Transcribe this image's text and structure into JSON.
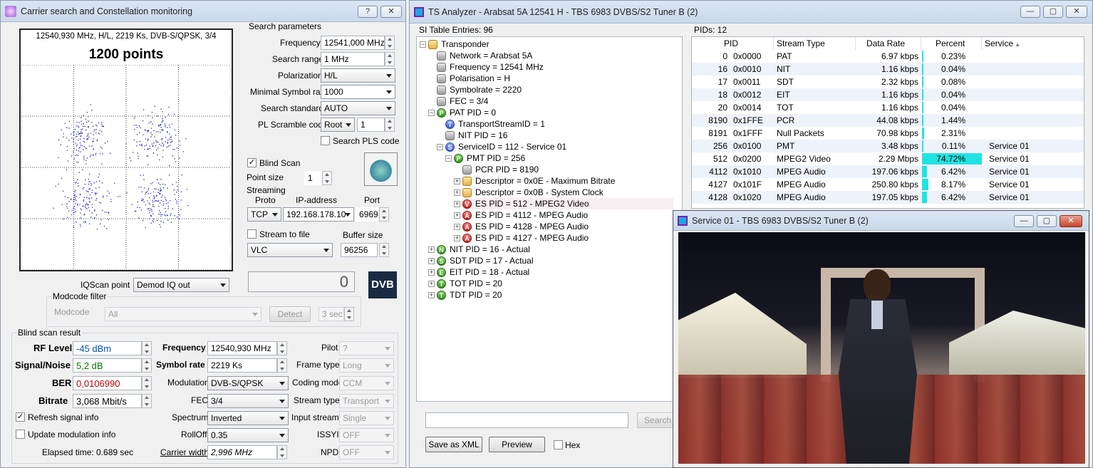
{
  "left_window": {
    "title": "Carrier search and Constellation monitoring",
    "help_btn": "?",
    "close_btn": "✕",
    "constellation": {
      "header": "12540,930 MHz, H/L, 2219 Ks, DVB-S/QPSK, 3/4",
      "points_label": "1200 points"
    },
    "search_params": {
      "title": "Search parameters",
      "frequency_label": "Frequency",
      "frequency_value": "12541,000 MHz",
      "range_label": "Search range",
      "range_value": "1 MHz",
      "polarization_label": "Polarization",
      "polarization_value": "H/L",
      "min_sr_label": "Minimal Symbol rate",
      "min_sr_value": "1000",
      "standard_label": "Search standard",
      "standard_value": "AUTO",
      "pls_label": "PL Scramble code",
      "pls_mode": "Root",
      "pls_value": "1",
      "search_pls_label": "Search PLS code"
    },
    "blind_scan_label": "Blind Scan",
    "point_size_label": "Point size",
    "point_size_value": "1",
    "streaming": {
      "title": "Streaming",
      "proto_label": "Proto",
      "ip_label": "IP-address",
      "port_label": "Port",
      "proto_value": "TCP",
      "ip_value": "192.168.178.10",
      "port_value": "6969"
    },
    "stream_to_file_label": "Stream to file",
    "buffer_label": "Buffer size",
    "player_value": "VLC",
    "buffer_value": "96256",
    "iqscan_label": "IQScan point",
    "iqscan_value": "Demod IQ out",
    "counter_value": "0",
    "dvb_logo": "DVB",
    "modcode_filter": {
      "title": "Modcode filter",
      "label": "Modcode",
      "value": "All",
      "detect": "Detect",
      "sec": "3 sec"
    },
    "result": {
      "title": "Blind scan result",
      "rf_label": "RF Level",
      "rf_value": "-45 dBm",
      "sn_label": "Signal/Noise",
      "sn_value": "5,2 dB",
      "ber_label": "BER",
      "ber_value": "0,0106990",
      "bitrate_label": "Bitrate",
      "bitrate_value": "3,068 Mbit/s",
      "freq_label": "Frequency",
      "freq_value": "12540,930 MHz",
      "sr_label": "Symbol rate",
      "sr_value": "2219 Ks",
      "mod_label": "Modulation",
      "mod_value": "DVB-S/QPSK",
      "fec_label": "FEC",
      "fec_value": "3/4",
      "spectrum_label": "Spectrum",
      "spectrum_value": "Inverted",
      "rolloff_label": "RollOff",
      "rolloff_value": "0.35",
      "cw_label": "Carrier width",
      "cw_value": "2,996 MHz",
      "pilot_label": "Pilot",
      "pilot_value": "?",
      "frame_label": "Frame type",
      "frame_value": "Long",
      "coding_label": "Coding mode",
      "coding_value": "CCM",
      "stype_label": "Stream type",
      "stype_value": "Transport",
      "istream_label": "Input stream",
      "istream_value": "Single",
      "issyi_label": "ISSYI",
      "issyi_value": "OFF",
      "npd_label": "NPD",
      "npd_value": "OFF",
      "refresh_label": "Refresh signal info",
      "update_label": "Update modulation info",
      "elapsed": "Elapsed time: 0.689 sec"
    }
  },
  "ts_window": {
    "title": "TS Analyzer - Arabsat 5A 12541 H - TBS 6983 DVBS/S2 Tuner B (2)",
    "si_label": "SI Table Entries: 96",
    "pids_label": "PIDs: 12",
    "tree": [
      {
        "text": "Transponder",
        "icon": "folder",
        "letter": ""
      },
      {
        "text": "Network = Arabsat 5A",
        "icon": "grey",
        "letter": ""
      },
      {
        "text": "Frequency = 12541 MHz",
        "icon": "grey",
        "letter": ""
      },
      {
        "text": "Polarisation = H",
        "icon": "grey",
        "letter": ""
      },
      {
        "text": "Symbolrate = 2220",
        "icon": "grey",
        "letter": ""
      },
      {
        "text": "FEC = 3/4",
        "icon": "grey",
        "letter": ""
      },
      {
        "text": "PAT PID = 0",
        "icon": "P",
        "letter": "P"
      },
      {
        "text": "TransportStreamID = 1",
        "icon": "T",
        "letter": "T"
      },
      {
        "text": "NIT PID = 16",
        "icon": "grey",
        "letter": ""
      },
      {
        "text": "ServiceID = 112 - Service 01",
        "icon": "Sv",
        "letter": "S"
      },
      {
        "text": "PMT PID = 256",
        "icon": "P",
        "letter": "P"
      },
      {
        "text": "PCR PID = 8190",
        "icon": "grey",
        "letter": ""
      },
      {
        "text": "Descriptor = 0x0E - Maximum Bitrate",
        "icon": "folder",
        "letter": ""
      },
      {
        "text": "Descriptor = 0x0B - System Clock",
        "icon": "folder",
        "letter": ""
      },
      {
        "text": "ES PID = 512 - MPEG2 Video",
        "icon": "V",
        "letter": "V"
      },
      {
        "text": "ES PID = 4112 - MPEG Audio",
        "icon": "A",
        "letter": "A"
      },
      {
        "text": "ES PID = 4128 - MPEG Audio",
        "icon": "A",
        "letter": "A"
      },
      {
        "text": "ES PID = 4127 - MPEG Audio",
        "icon": "A",
        "letter": "A"
      },
      {
        "text": "NIT PID = 16 - Actual",
        "icon": "N",
        "letter": "N"
      },
      {
        "text": "SDT PID = 17 - Actual",
        "icon": "S",
        "letter": "S"
      },
      {
        "text": "EIT PID = 18 - Actual",
        "icon": "E",
        "letter": "E"
      },
      {
        "text": "TOT PID = 20",
        "icon": "T2",
        "letter": "T"
      },
      {
        "text": "TDT PID = 20",
        "icon": "T2",
        "letter": "T"
      }
    ],
    "pid_headers": [
      "PID",
      "Stream Type",
      "Data Rate",
      "Percent",
      "Service"
    ],
    "pid_rows": [
      {
        "pid": "0",
        "hex": "0x0000",
        "type": "PAT",
        "rate": "6.97 kbps",
        "pct": "0.23%",
        "pctv": 0.23,
        "svc": ""
      },
      {
        "pid": "16",
        "hex": "0x0010",
        "type": "NIT",
        "rate": "1.16 kbps",
        "pct": "0.04%",
        "pctv": 0.04,
        "svc": ""
      },
      {
        "pid": "17",
        "hex": "0x0011",
        "type": "SDT",
        "rate": "2.32 kbps",
        "pct": "0.08%",
        "pctv": 0.08,
        "svc": ""
      },
      {
        "pid": "18",
        "hex": "0x0012",
        "type": "EIT",
        "rate": "1.16 kbps",
        "pct": "0.04%",
        "pctv": 0.04,
        "svc": ""
      },
      {
        "pid": "20",
        "hex": "0x0014",
        "type": "TOT",
        "rate": "1.16 kbps",
        "pct": "0.04%",
        "pctv": 0.04,
        "svc": ""
      },
      {
        "pid": "8190",
        "hex": "0x1FFE",
        "type": "PCR",
        "rate": "44.08 kbps",
        "pct": "1.44%",
        "pctv": 1.44,
        "svc": ""
      },
      {
        "pid": "8191",
        "hex": "0x1FFF",
        "type": "Null Packets",
        "rate": "70.98 kbps",
        "pct": "2.31%",
        "pctv": 2.31,
        "svc": ""
      },
      {
        "pid": "256",
        "hex": "0x0100",
        "type": "PMT",
        "rate": "3.48 kbps",
        "pct": "0.11%",
        "pctv": 0.11,
        "svc": "Service 01"
      },
      {
        "pid": "512",
        "hex": "0x0200",
        "type": "MPEG2 Video",
        "rate": "2.29 Mbps",
        "pct": "74.72%",
        "pctv": 74.72,
        "svc": "Service 01"
      },
      {
        "pid": "4112",
        "hex": "0x1010",
        "type": "MPEG Audio",
        "rate": "197.06 kbps",
        "pct": "6.42%",
        "pctv": 6.42,
        "svc": "Service 01"
      },
      {
        "pid": "4127",
        "hex": "0x101F",
        "type": "MPEG Audio",
        "rate": "250.80 kbps",
        "pct": "8.17%",
        "pctv": 8.17,
        "svc": "Service 01"
      },
      {
        "pid": "4128",
        "hex": "0x1020",
        "type": "MPEG Audio",
        "rate": "197.05 kbps",
        "pct": "6.42%",
        "pctv": 6.42,
        "svc": "Service 01"
      }
    ],
    "search_btn": "Search",
    "save_xml": "Save as XML",
    "preview": "Preview",
    "hex_label": "Hex"
  },
  "video_window": {
    "title": "Service 01 - TBS 6983 DVBS/S2 Tuner B (2)"
  },
  "colors": {
    "bar": "#21e3e3",
    "ber": "#c00000",
    "sn": "#007a00",
    "rf": "#0050c0"
  }
}
